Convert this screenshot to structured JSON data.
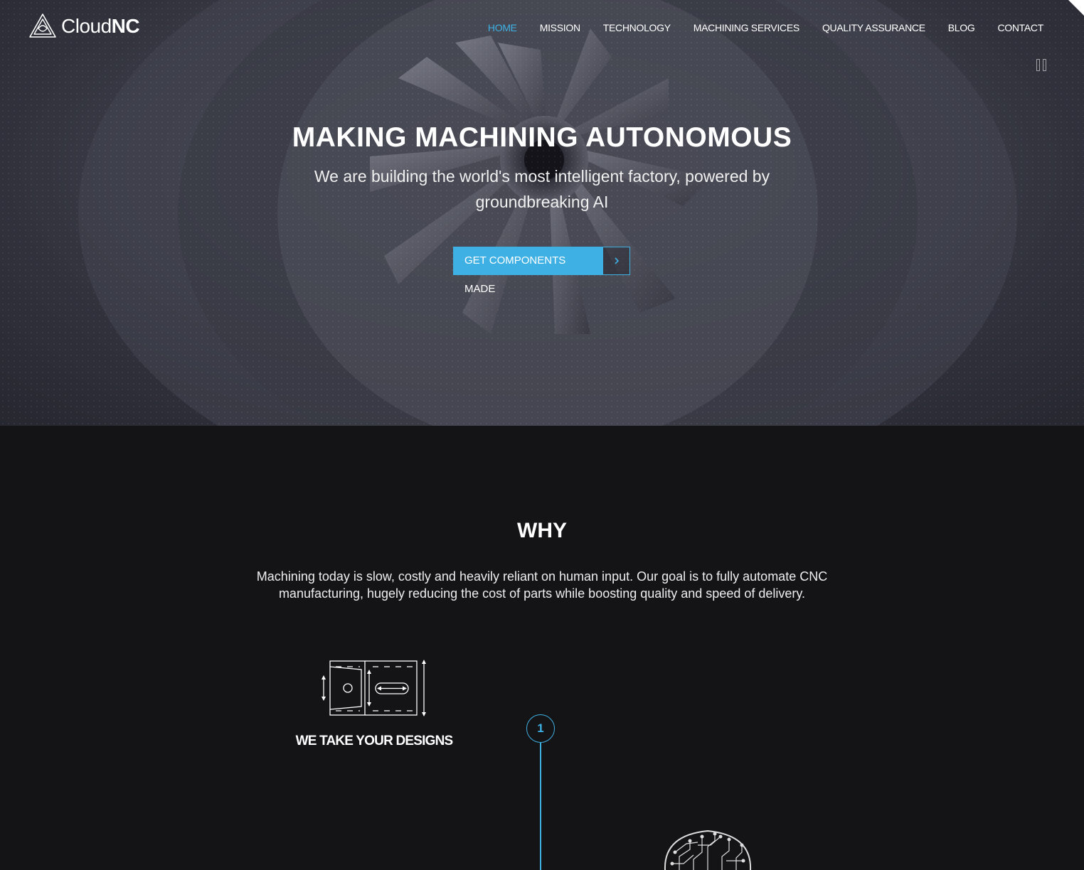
{
  "brand": {
    "name_thin": "Cloud",
    "name_bold": "NC"
  },
  "nav": {
    "items": [
      {
        "label": "HOME",
        "active": true
      },
      {
        "label": "MISSION",
        "active": false
      },
      {
        "label": "TECHNOLOGY",
        "active": false
      },
      {
        "label": "MACHINING SERVICES",
        "active": false
      },
      {
        "label": "QUALITY ASSURANCE",
        "active": false
      },
      {
        "label": "BLOG",
        "active": false
      },
      {
        "label": "CONTACT",
        "active": false
      }
    ]
  },
  "hero": {
    "title": "MAKING MACHINING AUTONOMOUS",
    "subtitle": "We are building the world's most intelligent factory, powered by groundbreaking AI",
    "cta_label": "GET COMPONENTS MADE",
    "cta_icon": "chevron-right-icon",
    "media_control_icon": "pause-icon"
  },
  "why": {
    "title": "WHY",
    "text": "Machining today is slow, costly and heavily reliant on human input. Our goal is to fully automate CNC manufacturing, hugely reducing the cost of parts while boosting quality and speed of delivery.",
    "steps": [
      {
        "number": "1",
        "label": "WE TAKE YOUR DESIGNS",
        "icon": "design-drawing-icon"
      }
    ]
  },
  "colors": {
    "accent": "#3fb0e4",
    "background": "#141416",
    "text": "#ffffff"
  }
}
